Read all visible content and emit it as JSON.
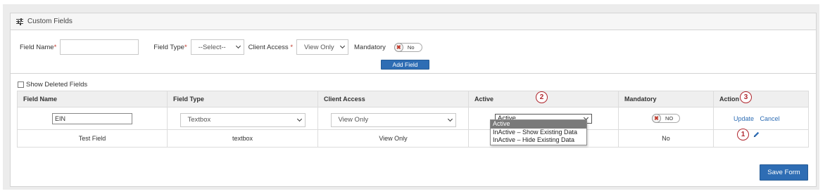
{
  "header": {
    "title": "Custom Fields",
    "icon": "sliders-icon"
  },
  "form": {
    "field_name_label": "Field Name",
    "field_type_label": "Field Type",
    "field_type_value": "--Select--",
    "client_access_label": "Client Access",
    "client_access_value": "View Only",
    "mandatory_label": "Mandatory",
    "mandatory_toggle": "No",
    "required_mark": "*",
    "add_button": "Add Field"
  },
  "show_deleted_label": "Show Deleted Fields",
  "table": {
    "headers": [
      "Field Name",
      "Field Type",
      "Client Access",
      "Active",
      "Mandatory",
      "Action"
    ],
    "edit_row": {
      "field_name": "EIN",
      "field_type": "Textbox",
      "client_access": "View Only",
      "active": "Active",
      "mandatory": "NO",
      "update": "Update",
      "cancel": "Cancel"
    },
    "rows": [
      {
        "field_name": "Test Field",
        "field_type": "textbox",
        "client_access": "View Only",
        "mandatory": "No"
      }
    ]
  },
  "active_options": [
    "Active",
    "InActive – Show Existing Data",
    "InActive – Hide Existing Data"
  ],
  "badges": [
    "1",
    "2",
    "3"
  ],
  "save_button": "Save Form",
  "colors": {
    "primary": "#2e6db4",
    "badge": "#b0272e",
    "required": "#c0392b"
  }
}
